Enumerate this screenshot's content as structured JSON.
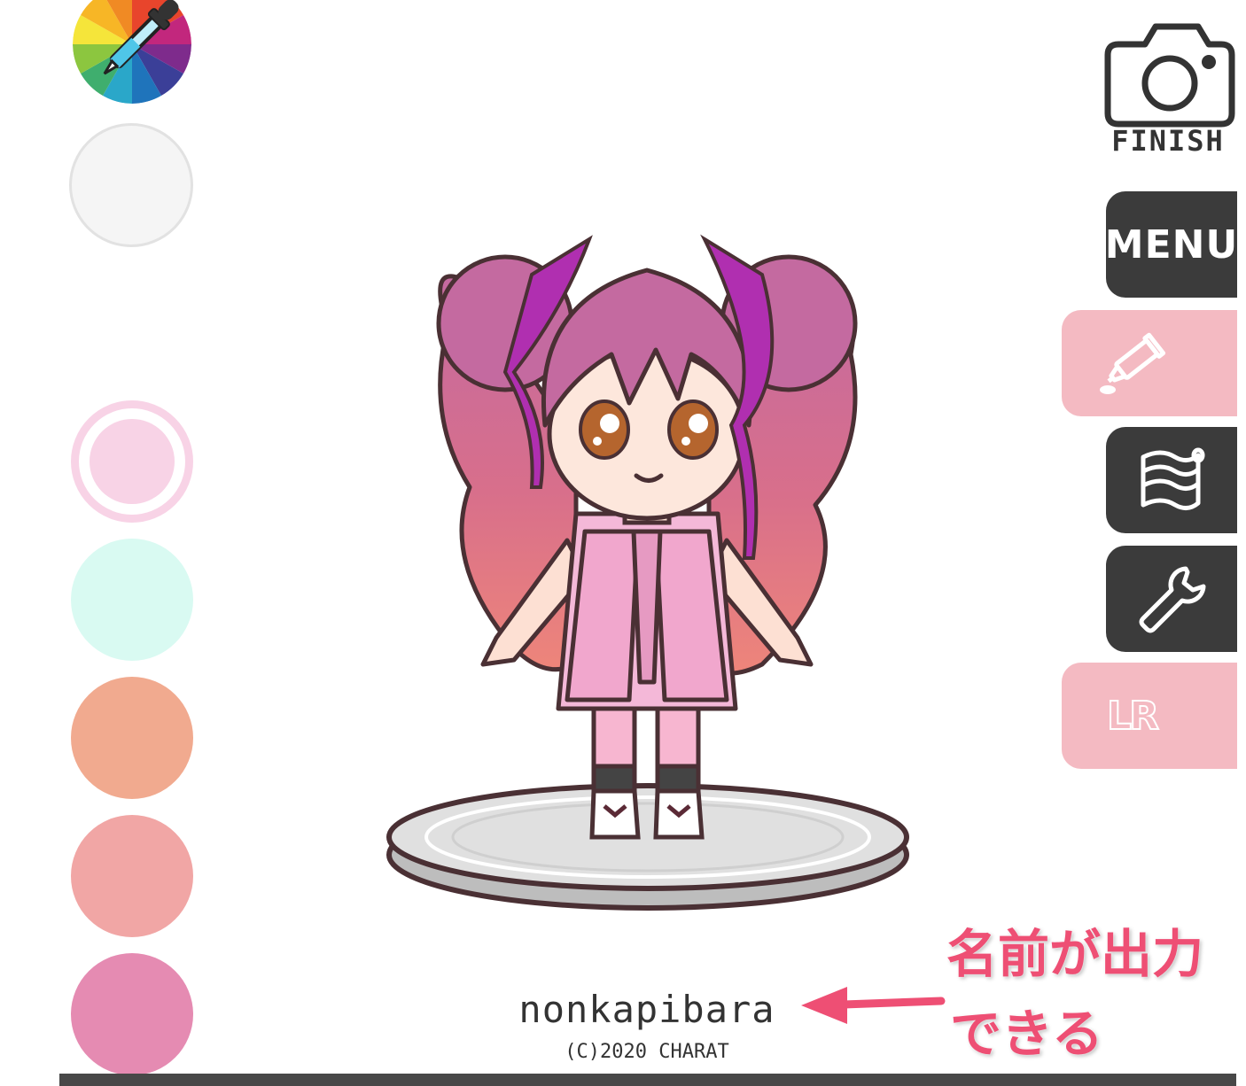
{
  "toolbar": {
    "finish_label": "FINISH",
    "menu_label": "MENU",
    "lr_label": "LR",
    "icons": [
      "camera-icon",
      "paint-tube-icon",
      "fabric-roll-icon",
      "wrench-icon"
    ]
  },
  "palette": {
    "swatches": [
      {
        "name": "white",
        "color": "#f5f5f5",
        "selected": false
      },
      {
        "name": "light-pink",
        "color": "#f8d3e6",
        "selected": true
      },
      {
        "name": "mint",
        "color": "#d9faf2",
        "selected": false
      },
      {
        "name": "peach",
        "color": "#f1aa8f",
        "selected": false
      },
      {
        "name": "salmon",
        "color": "#f1a6a5",
        "selected": false
      },
      {
        "name": "rose",
        "color": "#e58bb2",
        "selected": false
      }
    ]
  },
  "character": {
    "name": "nonkapibara",
    "copyright": "(C)2020 CHARAT"
  },
  "annotation": {
    "line1": "名前が出力",
    "line2": "できる",
    "color": "#ee4f74"
  },
  "colors": {
    "button_dark": "#3b3b3b",
    "button_pink": "#f4bac2",
    "hair": "#c96a9e",
    "bottom_bar": "#484848"
  }
}
